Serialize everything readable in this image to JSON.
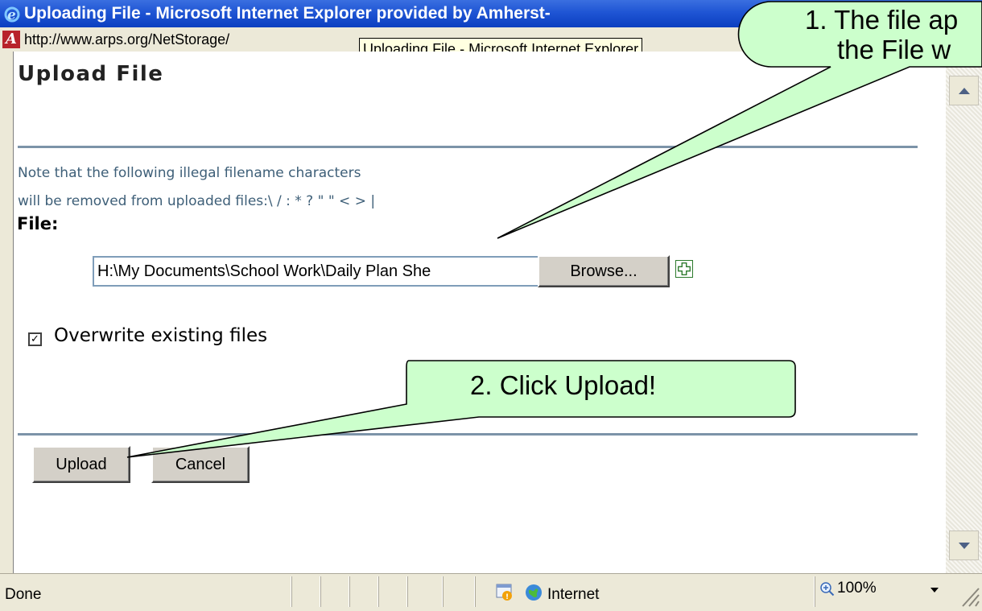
{
  "window": {
    "title": "Uploading File - Microsoft Internet Explorer provided by Amherst-",
    "url": "http://www.arps.org/NetStorage/",
    "tooltip": "Uploading File - Microsoft Internet Explorer"
  },
  "page": {
    "title": "Upload File",
    "note_line1": "Note that the following illegal filename characters",
    "note_line2": "will be removed from uploaded files:\\ / : * ? \" \" < > |",
    "file_label": "File:",
    "file_value": "H:\\My Documents\\School Work\\Daily Plan She",
    "browse_label": "Browse...",
    "overwrite_label": "Overwrite existing files",
    "overwrite_checked": true,
    "check_mark": "✓",
    "upload_label": "Upload",
    "cancel_label": "Cancel"
  },
  "status": {
    "text": "Done",
    "zone": "Internet",
    "zoom": "100%"
  },
  "callouts": {
    "first_line1": "1. The file ap",
    "first_line2": "the File w",
    "second": "2.  Click Upload!"
  },
  "icons": {
    "title_icon": "ie-logo-icon",
    "address_icon": "page-icon",
    "add_icon": "plus-icon",
    "zone_icon": "globe-icon",
    "zoom_icon": "magnifier-icon"
  },
  "colors": {
    "titlebar": "#0b3fc0",
    "callout_fill": "#ccffcc",
    "note_text": "#3e5f78",
    "rule": "#7c93a8"
  }
}
